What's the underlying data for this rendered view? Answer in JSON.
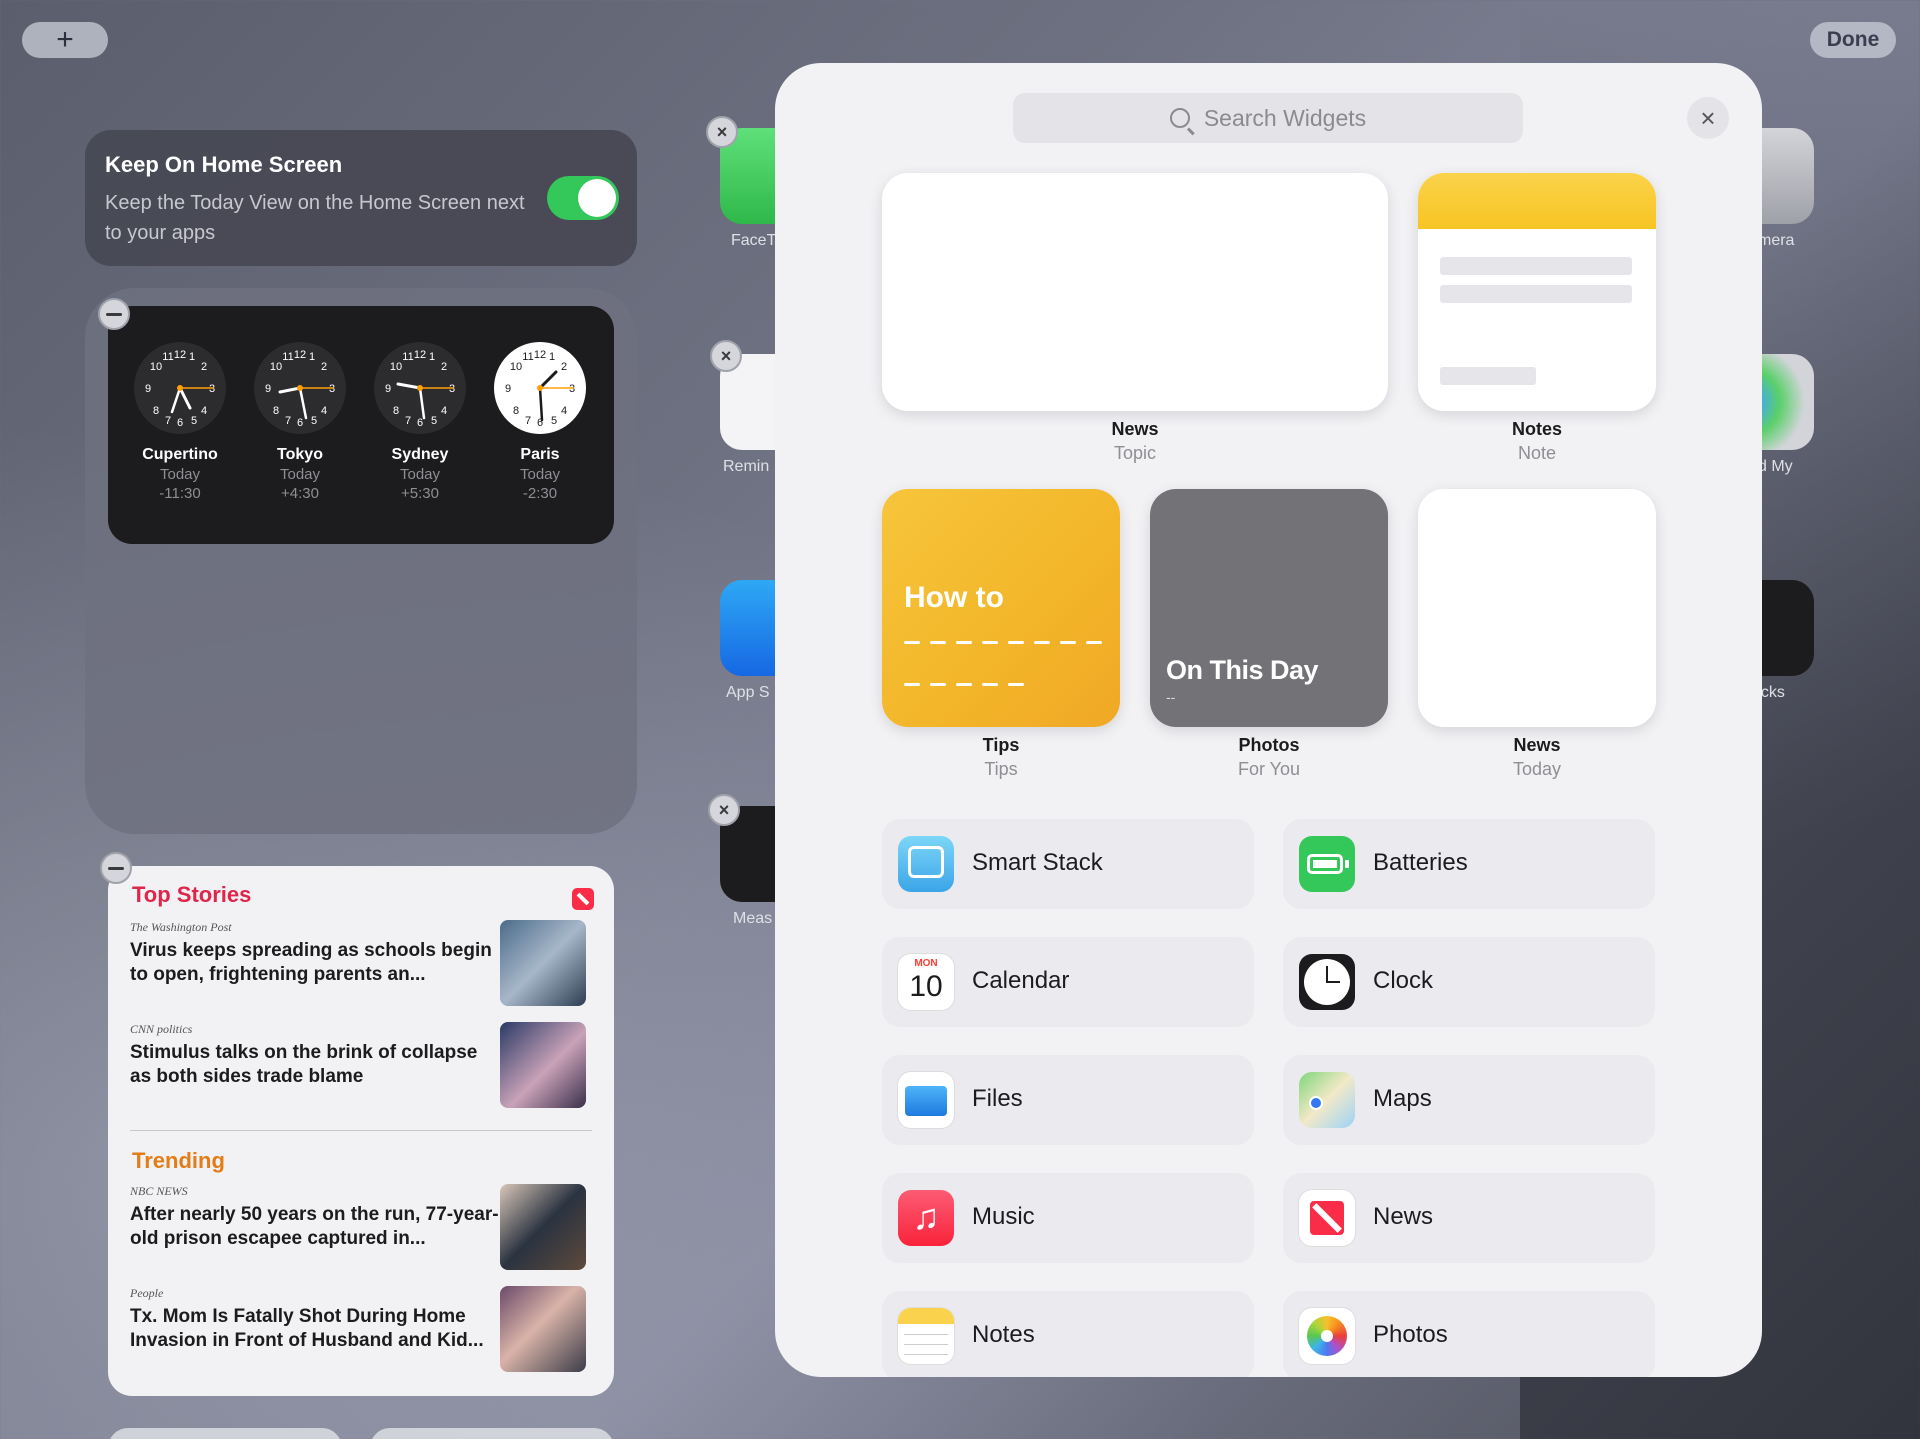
{
  "toolbar": {
    "add_label": "+",
    "done_label": "Done"
  },
  "keep_on_home": {
    "title": "Keep On Home Screen",
    "subtitle": "Keep the Today View on the Home Screen next to your apps",
    "enabled": true
  },
  "world_clock": {
    "clocks": [
      {
        "city": "Cupertino",
        "day": "Today",
        "offset": "-11:30"
      },
      {
        "city": "Tokyo",
        "day": "Today",
        "offset": "+4:30"
      },
      {
        "city": "Sydney",
        "day": "Today",
        "offset": "+5:30"
      },
      {
        "city": "Paris",
        "day": "Today",
        "offset": "-2:30"
      }
    ]
  },
  "news_widget": {
    "header": "Top Stories",
    "trending_header": "Trending",
    "stories": [
      {
        "source": "The Washington Post",
        "title": "Virus keeps spreading as schools begin to open, frightening parents an..."
      },
      {
        "source": "CNN politics",
        "title": "Stimulus talks on the brink of collapse as both sides trade blame"
      },
      {
        "source": "NBC NEWS",
        "title": "After nearly 50 years on the run, 77-year-old prison escapee captured in..."
      },
      {
        "source": "People",
        "title": "Tx. Mom Is Fatally Shot During Home Invasion in Front of Husband and Kid..."
      }
    ]
  },
  "background_apps": [
    {
      "label": "FaceT"
    },
    {
      "label": "Remin"
    },
    {
      "label": "App S"
    },
    {
      "label": "Meas"
    },
    {
      "label": "mera"
    },
    {
      "label": "d My"
    },
    {
      "label": "ocks"
    }
  ],
  "gallery": {
    "search_placeholder": "Search Widgets",
    "close_icon": "×",
    "featured": [
      {
        "name": "News",
        "kind": "Topic"
      },
      {
        "name": "Notes",
        "kind": "Note"
      },
      {
        "name": "Tips",
        "kind": "Tips",
        "text": "How to"
      },
      {
        "name": "Photos",
        "kind": "For You",
        "text": "On This Day",
        "sub": "--"
      },
      {
        "name": "News",
        "kind": "Today"
      }
    ],
    "apps": [
      {
        "label": "Smart Stack",
        "icon": "smart-stack-icon"
      },
      {
        "label": "Batteries",
        "icon": "batteries-icon"
      },
      {
        "label": "Calendar",
        "icon": "calendar-icon",
        "month": "MON",
        "day": "10"
      },
      {
        "label": "Clock",
        "icon": "clock-icon"
      },
      {
        "label": "Files",
        "icon": "files-icon"
      },
      {
        "label": "Maps",
        "icon": "maps-icon"
      },
      {
        "label": "Music",
        "icon": "music-icon"
      },
      {
        "label": "News",
        "icon": "news-icon"
      },
      {
        "label": "Notes",
        "icon": "notes-icon"
      },
      {
        "label": "Photos",
        "icon": "photos-icon"
      }
    ]
  },
  "colors": {
    "toggle_on": "#34c759",
    "news_red": "#e0254a",
    "trending_orange": "#e37d18",
    "tips_yellow": "#f6c53b",
    "notes_yellow": "#f7c522"
  }
}
